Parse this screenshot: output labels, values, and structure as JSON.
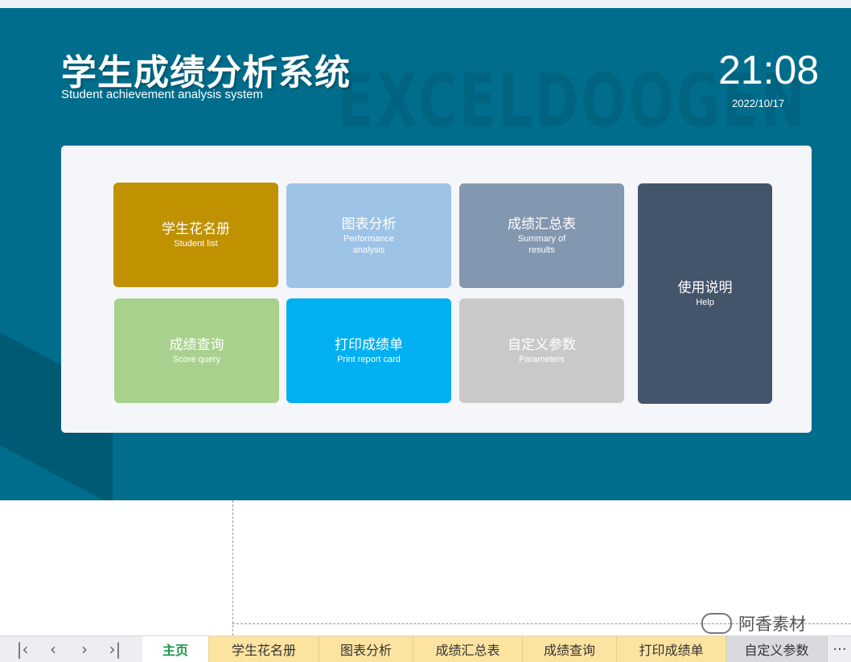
{
  "header": {
    "title": "学生成绩分析系统",
    "subtitle": "Student achievement analysis system",
    "time": "21:08",
    "date": "2022/10/17",
    "watermark": "EXCELDOOGEN"
  },
  "tiles": [
    {
      "label": "学生花名册",
      "sublabel": "Student list",
      "color": "#c09100"
    },
    {
      "label": "图表分析",
      "sublabel": "Performance analysis",
      "color": "#9dc3e6"
    },
    {
      "label": "成绩汇总表",
      "sublabel": "Summary of results",
      "color": "#8497b0"
    },
    {
      "label": "使用说明",
      "sublabel": "Help",
      "color": "#44546a"
    },
    {
      "label": "成绩查询",
      "sublabel": "Score query",
      "color": "#a9d18e"
    },
    {
      "label": "打印成绩单",
      "sublabel": "Print report card",
      "color": "#00b0f0"
    },
    {
      "label": "自定义参数",
      "sublabel": "Parameters",
      "color": "#c9c9c9"
    }
  ],
  "brand_watermark": "阿香素材",
  "sheet_tabs": [
    "主页",
    "学生花名册",
    "图表分析",
    "成绩汇总表",
    "成绩查询",
    "打印成绩单",
    "自定义参数"
  ],
  "nav_icons": [
    "first-sheet-icon",
    "prev-sheet-icon",
    "next-sheet-icon",
    "last-sheet-icon"
  ],
  "more_label": "···"
}
